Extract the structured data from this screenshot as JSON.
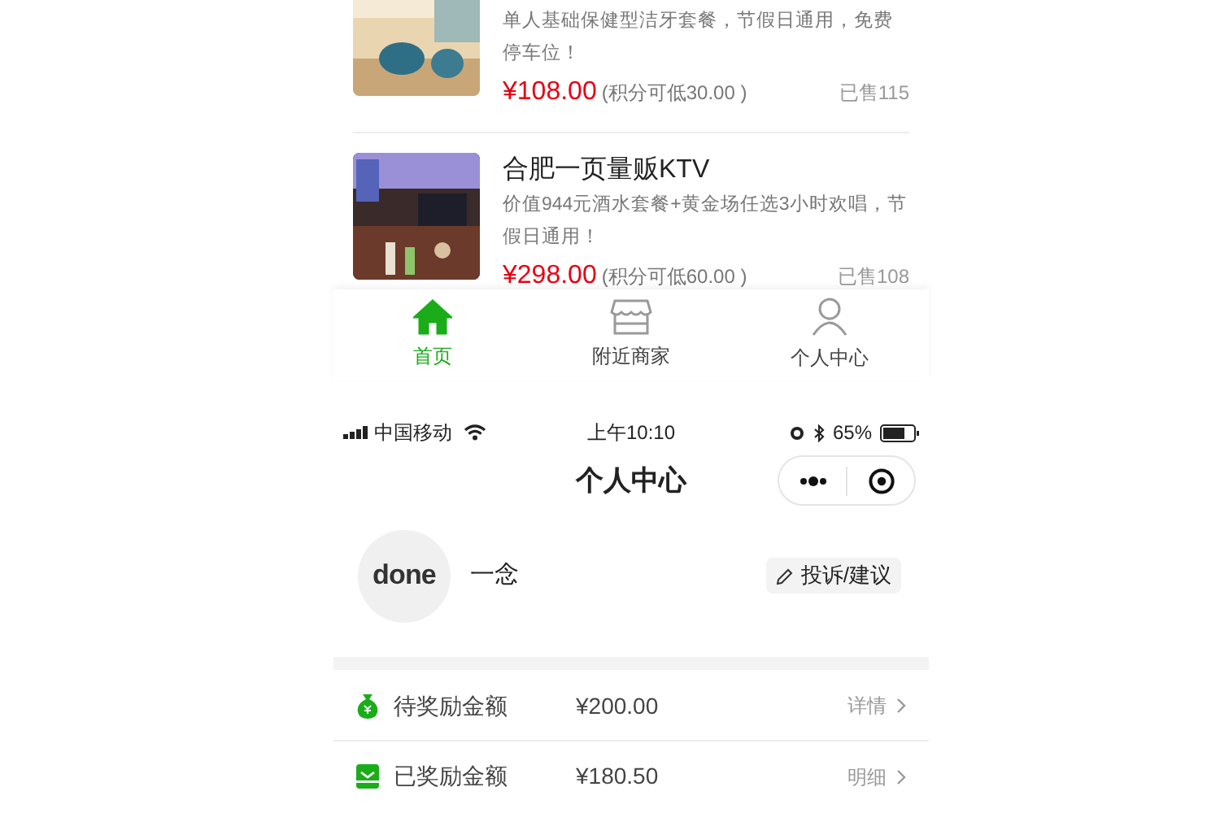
{
  "deals": [
    {
      "description": "单人基础保健型洁牙套餐，节假日通用，免费停车位！",
      "price": "¥108.00",
      "points": "(积分可低30.00 )",
      "sold": "已售115"
    },
    {
      "title": "合肥一页量贩KTV",
      "description": "价值944元酒水套餐+黄金场任选3小时欢唱，节假日通用！",
      "price": "¥298.00",
      "points": "(积分可低60.00 )",
      "sold": "已售108"
    }
  ],
  "tab_bar": [
    {
      "label": "首页",
      "kind": "home",
      "selected": true
    },
    {
      "label": "附近商家",
      "kind": "shop",
      "selected": false
    },
    {
      "label": "个人中心",
      "kind": "person",
      "selected": false
    }
  ],
  "status_bar": {
    "carrier": "中国移动",
    "time": "上午10:10",
    "battery": "65%"
  },
  "header": {
    "title": "个人中心"
  },
  "profile": {
    "avatar_text": "done",
    "name": "一念",
    "feedback_button": "投诉/建议"
  },
  "rewards": [
    {
      "kind": "pending",
      "label": "待奖励金额",
      "amount": "¥200.00",
      "link": "详情"
    },
    {
      "kind": "paid",
      "label": "已奖励金额",
      "amount": "¥180.50",
      "link": "明细"
    }
  ]
}
